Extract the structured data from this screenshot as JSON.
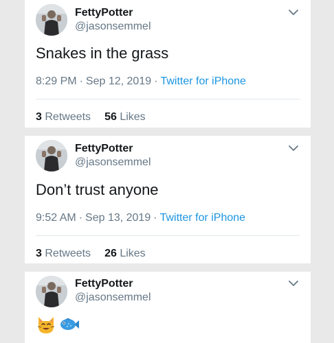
{
  "tweets": [
    {
      "author_name": "FettyPotter",
      "author_handle": "@jasonsemmel",
      "text": "Snakes in the grass",
      "time": "8:29 PM",
      "date": "Sep 12, 2019",
      "source": "Twitter for iPhone",
      "retweets_count": "3",
      "retweets_label": "Retweets",
      "likes_count": "56",
      "likes_label": "Likes"
    },
    {
      "author_name": "FettyPotter",
      "author_handle": "@jasonsemmel",
      "text": "Don’t trust anyone",
      "time": "9:52 AM",
      "date": "Sep 13, 2019",
      "source": "Twitter for iPhone",
      "retweets_count": "3",
      "retweets_label": "Retweets",
      "likes_count": "26",
      "likes_label": "Likes"
    },
    {
      "author_name": "FettyPotter",
      "author_handle": "@jasonsemmel",
      "emojis": [
        "cat-emoji",
        "fish-emoji"
      ]
    }
  ],
  "colors": {
    "link_blue": "#1b95e0",
    "secondary_text": "#657786",
    "primary_text": "#14171a",
    "background": "#e9e9ea"
  }
}
